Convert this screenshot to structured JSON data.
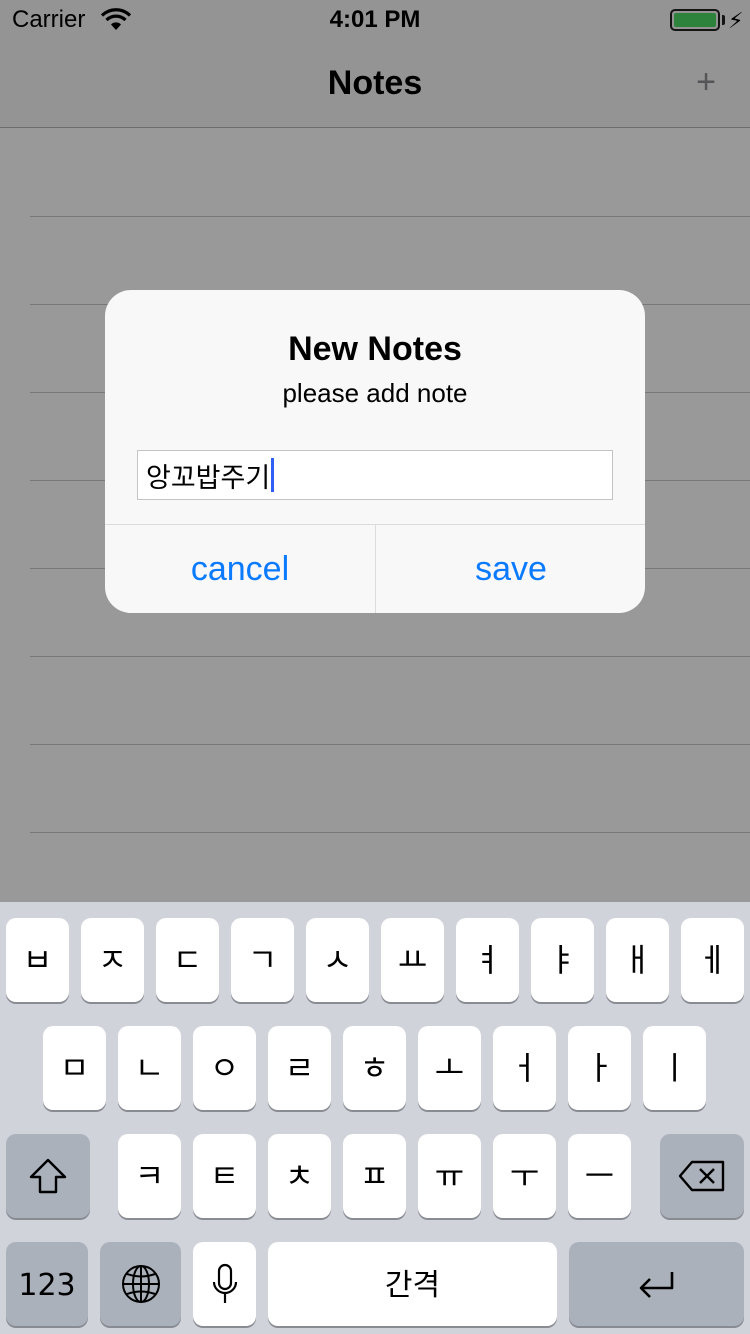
{
  "status_bar": {
    "carrier": "Carrier",
    "time": "4:01 PM"
  },
  "nav": {
    "title": "Notes",
    "add_label": "+"
  },
  "alert": {
    "title": "New Notes",
    "message": "please add note",
    "input_value": "앙꼬밥주기",
    "cancel_label": "cancel",
    "save_label": "save"
  },
  "keyboard": {
    "row1": [
      "ㅂ",
      "ㅈ",
      "ㄷ",
      "ㄱ",
      "ㅅ",
      "ㅛ",
      "ㅕ",
      "ㅑ",
      "ㅐ",
      "ㅔ"
    ],
    "row2": [
      "ㅁ",
      "ㄴ",
      "ㅇ",
      "ㄹ",
      "ㅎ",
      "ㅗ",
      "ㅓ",
      "ㅏ",
      "ㅣ"
    ],
    "row3": [
      "ㅋ",
      "ㅌ",
      "ㅊ",
      "ㅍ",
      "ㅠ",
      "ㅜ",
      "ㅡ"
    ],
    "numbers_label": "123",
    "space_label": "간격"
  },
  "colors": {
    "accent": "#0a7aff",
    "battery": "#4cd964",
    "caret": "#2f5ff5"
  }
}
